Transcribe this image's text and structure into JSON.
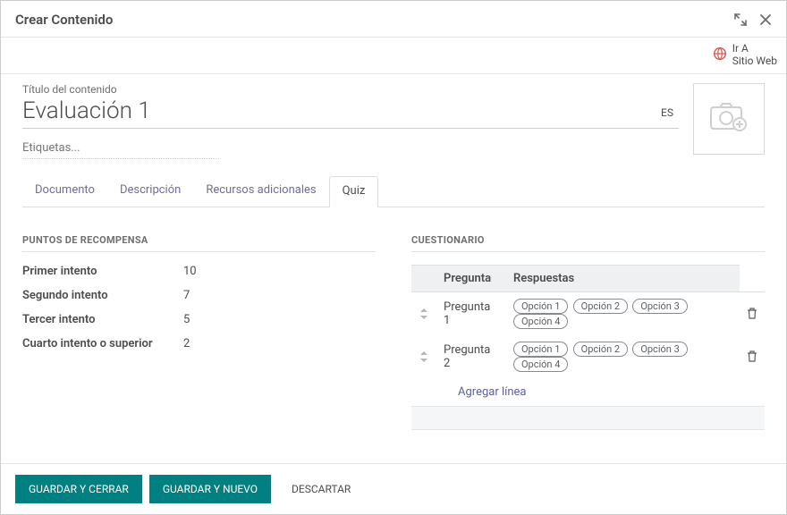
{
  "modal": {
    "title": "Crear Contenido"
  },
  "go_to_web": {
    "line1": "Ir A",
    "line2": "Sitio Web"
  },
  "content_title": {
    "label": "Título del contenido",
    "value": "Evaluación 1",
    "lang": "ES"
  },
  "tags": {
    "placeholder": "Etiquetas..."
  },
  "tabs": {
    "documento": "Documento",
    "descripcion": "Descripción",
    "recursos": "Recursos adicionales",
    "quiz": "Quiz"
  },
  "reward": {
    "heading": "PUNTOS DE RECOMPENSA",
    "rows": [
      {
        "label": "Primer intento",
        "value": "10"
      },
      {
        "label": "Segundo intento",
        "value": "7"
      },
      {
        "label": "Tercer intento",
        "value": "5"
      },
      {
        "label": "Cuarto intento o superior",
        "value": "2"
      }
    ]
  },
  "quiz": {
    "heading": "CUESTIONARIO",
    "cols": {
      "question": "Pregunta",
      "answers": "Respuestas"
    },
    "rows": [
      {
        "q": "Pregunta 1",
        "opts": [
          "Opción 1",
          "Opción 2",
          "Opción 3",
          "Opción 4"
        ]
      },
      {
        "q": "Pregunta 2",
        "opts": [
          "Opción 1",
          "Opción 2",
          "Opción 3",
          "Opción 4"
        ]
      }
    ],
    "add_line": "Agregar línea"
  },
  "footer": {
    "save_close": "GUARDAR Y CERRAR",
    "save_new": "GUARDAR Y NUEVO",
    "discard": "DESCARTAR"
  }
}
